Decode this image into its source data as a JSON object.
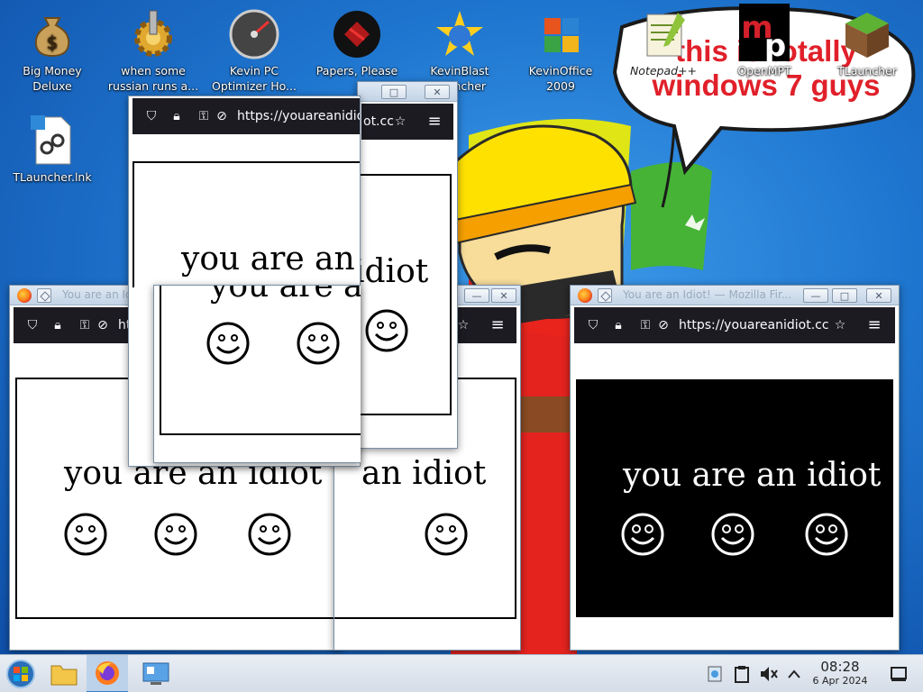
{
  "desktop": {
    "icons": [
      {
        "label": "Big Money Deluxe"
      },
      {
        "label": "when some russian runs a..."
      },
      {
        "label": "Kevin PC Optimizer Ho..."
      },
      {
        "label": "Papers, Please"
      },
      {
        "label": "KevinBlast Launcher"
      },
      {
        "label": "KevinOffice 2009"
      },
      {
        "label": "Notepad++"
      },
      {
        "label": "OpenMPT"
      },
      {
        "label": "TLauncher"
      },
      {
        "label": "TLauncher.lnk"
      }
    ],
    "speech_bubble": "this is totally windows 7 guys"
  },
  "browser": {
    "window_title": "You are an Idiot! — Mozilla Fir...",
    "window_title_short": "you are an Idiot!",
    "url": "https://youareanidiot.cc",
    "url_cut_a": "https://youareanidio",
    "url_cut_b": "ot.cc",
    "url_cut_c": "https",
    "page_text": "you are an idiot",
    "page_text_cut_a": "you are an ic",
    "page_text_cut_b": "you are an",
    "page_text_cut_c": "idiot",
    "page_text_cut_d": "an idiot",
    "minimize_glyph": "—",
    "maximize_glyph": "□",
    "close_glyph": "✕",
    "menu_glyph": "≡",
    "star_glyph": "☆"
  },
  "taskbar": {
    "time": "08:28",
    "date": "6 Apr 2024"
  },
  "colors": {
    "accent": "#3b7ccb",
    "browser_toolbar": "#1c1b22",
    "bubble_text": "#e0202a"
  }
}
